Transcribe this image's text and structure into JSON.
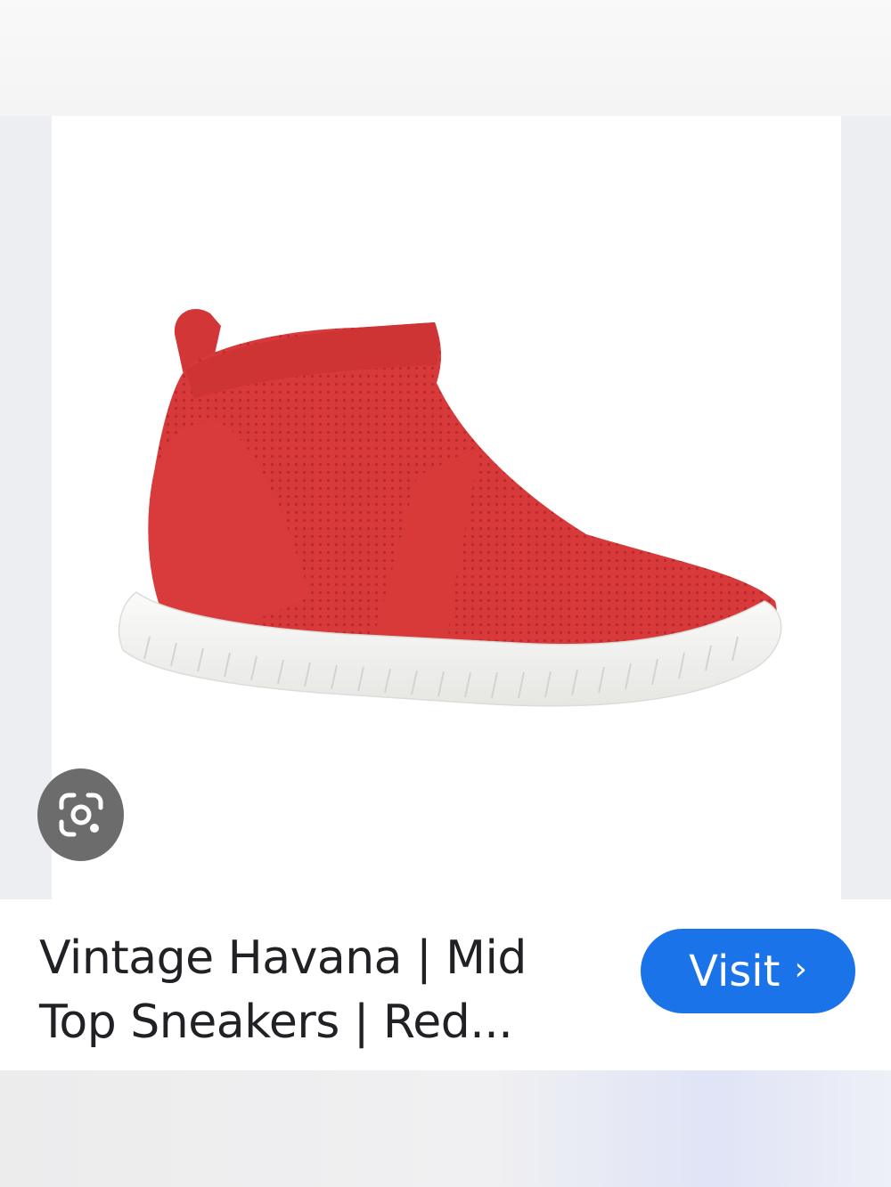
{
  "result": {
    "title_line1": "Vintage Havana | Mid",
    "title_line2": "Top Sneakers | Red...",
    "visit_label": "Visit",
    "visit_chevron": "›"
  },
  "icons": {
    "lens": "google-lens-icon",
    "visit_chevron": "chevron-right-icon"
  },
  "colors": {
    "visit_button": "#1a73e8",
    "lens_button": "#6c6c6c",
    "shoe_upper": "#d8393a",
    "shoe_sole": "#f4f4f2"
  }
}
